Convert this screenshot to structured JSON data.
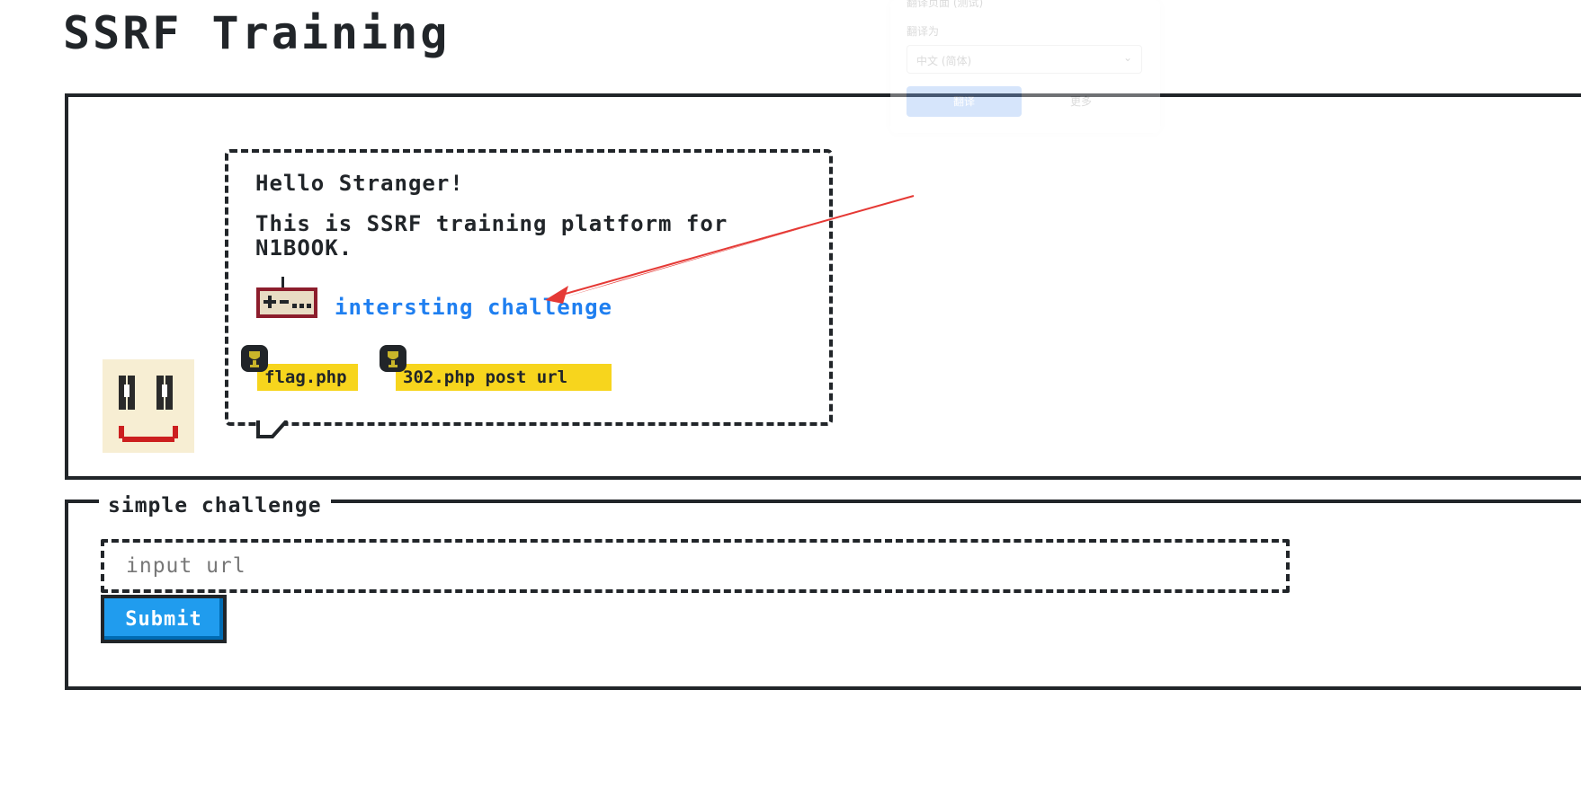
{
  "page": {
    "title": "SSRF Training"
  },
  "hero": {
    "greeting": "Hello Stranger!",
    "intro": "This is SSRF training platform for N1BOOK.",
    "challenge_link": "intersting challenge",
    "files": [
      "flag.php",
      "302.php post url"
    ]
  },
  "translate_popup": {
    "header": "翻译页面 (测试)",
    "label": "翻译为",
    "language": "中文 (简体)",
    "button": "翻译",
    "more": "更多"
  },
  "form": {
    "legend": "simple challenge",
    "url_placeholder": "input url",
    "submit_label": "Submit"
  },
  "colors": {
    "accent": "#209cee",
    "badge": "#f7d51d",
    "arrow": "#e53935",
    "border": "#212529"
  },
  "icons": [
    "smiley-avatar-icon",
    "game-controller-icon",
    "trophy-icon",
    "arrow-annotation-icon"
  ]
}
